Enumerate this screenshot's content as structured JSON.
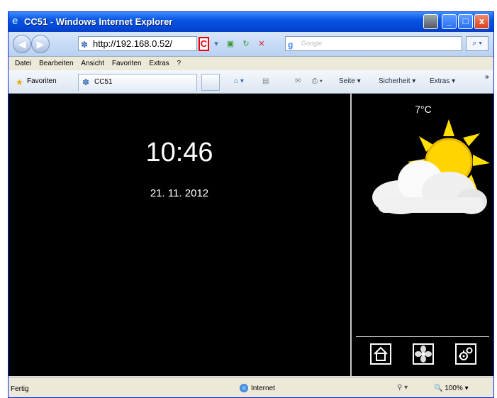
{
  "window": {
    "title": "CC51 - Windows Internet Explorer",
    "controls": [
      "_",
      "□",
      "x"
    ]
  },
  "navigation": {
    "back_icon": "back-arrow-icon",
    "forward_icon": "forward-arrow-icon",
    "address": "http://192.168.0.52/",
    "marker_label": "C",
    "search_placeholder": "Google",
    "search_icon": "magnifier-icon"
  },
  "menu": {
    "items": [
      "Datei",
      "Bearbeiten",
      "Ansicht",
      "Favoriten",
      "Extras",
      "?"
    ]
  },
  "favorites_bar": {
    "favorites_label": "Favoriten",
    "tab_title": "CC51",
    "page_label": "Seite",
    "security_label": "Sicherheit",
    "extras_label": "Extras",
    "overflow": "»"
  },
  "page": {
    "time": "10:46",
    "date": "21. 11. 2012",
    "temperature": "7°C",
    "weather_icon": "sun-behind-cloud-icon",
    "buttons": [
      "home-icon",
      "fan-icon",
      "settings-gears-icon"
    ]
  },
  "status": {
    "left_text": "Fertig",
    "zone": "Internet",
    "zoom": "100%"
  },
  "colors": {
    "title_bar": "#0a55e2",
    "page_background": "#000000",
    "accent_red": "#e00000"
  }
}
